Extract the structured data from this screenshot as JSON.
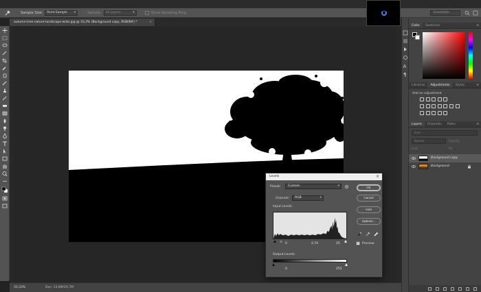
{
  "options_bar": {
    "sample_size_label": "Sample Size:",
    "sample_size_value": "Point Sample",
    "sample_label": "Sample:",
    "sample_value": "All Layers",
    "show_ring_label": "Show Sampling Ring",
    "workspace": "Essentials"
  },
  "document_tab": {
    "title": "autumn-tree-nature-landscape-wide.jpg @ 33,3% (Background copy, RGB/8#) *",
    "close": "×"
  },
  "status_bar": {
    "zoom": "33,33%",
    "doc_info": "Doc: 14,8M/29,7M"
  },
  "color_panel": {
    "tabs": [
      "Color",
      "Swatches"
    ],
    "active_tab": 0,
    "foreground_color": "#000000",
    "background_color": "#ffffff"
  },
  "adjustments_panel": {
    "tabs": [
      "Libraries",
      "Adjustments",
      "Styles"
    ],
    "active_tab": 1,
    "title": "Add an adjustment"
  },
  "layers_panel": {
    "tabs": [
      "Layers",
      "Channels",
      "Paths"
    ],
    "active_tab": 0,
    "filter_placeholder": "Kind",
    "blend_mode": "Normal",
    "opacity_label": "Opacity:",
    "lock_label": "Lock:",
    "fill_label": "Fill:",
    "layers": [
      {
        "name": "Background copy",
        "selected": true
      },
      {
        "name": "Background",
        "selected": false,
        "locked": true
      }
    ]
  },
  "levels_dialog": {
    "title": "Levels",
    "close": "×",
    "preset_label": "Preset:",
    "preset_value": "Custom",
    "channel_label": "Channel:",
    "channel_value": "RGB",
    "input_levels_label": "Input Levels:",
    "input_black": "0",
    "input_gamma": "2,74",
    "input_white": "25",
    "output_levels_label": "Output Levels:",
    "output_black": "0",
    "output_white": "255",
    "buttons": {
      "ok": "OK",
      "cancel": "Cancel",
      "auto": "Auto",
      "options": "Options..."
    },
    "preview_label": "Preview",
    "preview_checked": true,
    "checkmark": "✓"
  },
  "colors": {
    "accent_blue": "#2a8cff",
    "ui_dark": "#232323",
    "panel": "#434343"
  }
}
